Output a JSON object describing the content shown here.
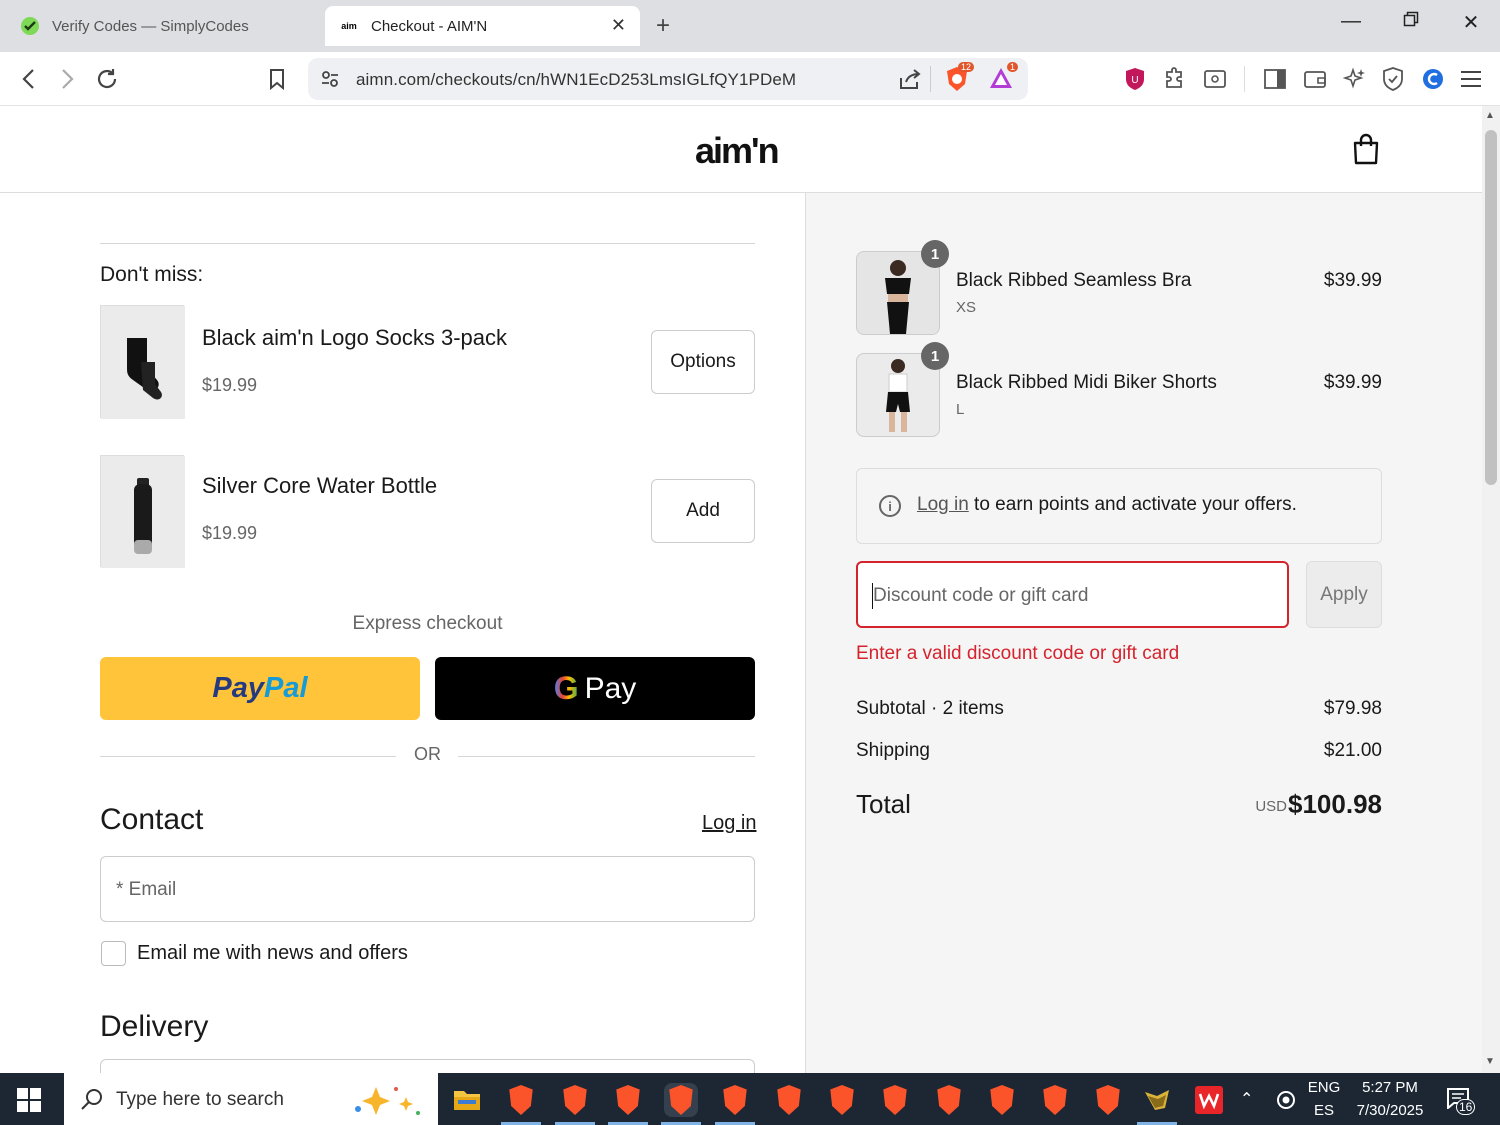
{
  "browser": {
    "tabs": [
      {
        "title": "Verify Codes — SimplyCodes",
        "active": false
      },
      {
        "title": "Checkout - AIM'N",
        "active": true
      }
    ],
    "url": "aimn.com/checkouts/cn/hWN1EcD253LmsIGLfQY1PDeM",
    "brave_shield_count": "12",
    "rewards_count": "1"
  },
  "site": {
    "logo": "aim'n"
  },
  "upsell": {
    "title": "Don't miss:",
    "items": [
      {
        "name": "Black aim'n Logo Socks 3-pack",
        "price": "$19.99",
        "button": "Options"
      },
      {
        "name": "Silver Core Water Bottle",
        "price": "$19.99",
        "button": "Add"
      }
    ]
  },
  "express": {
    "label": "Express checkout",
    "paypal_a": "Pay",
    "paypal_b": "Pal",
    "gpay_g": "G",
    "gpay_text": "Pay",
    "or": "OR"
  },
  "contact": {
    "heading": "Contact",
    "login": "Log in",
    "email_placeholder": "* Email",
    "newsletter_label": "Email me with news and offers"
  },
  "delivery": {
    "heading": "Delivery"
  },
  "summary": {
    "items": [
      {
        "name": "Black Ribbed Seamless Bra",
        "variant": "XS",
        "price": "$39.99",
        "qty": "1"
      },
      {
        "name": "Black Ribbed Midi Biker Shorts",
        "variant": "L",
        "price": "$39.99",
        "qty": "1"
      }
    ],
    "login_link": "Log in",
    "login_text": " to earn points and activate your offers.",
    "discount_placeholder": "Discount code or gift card",
    "apply": "Apply",
    "error": "Enter a valid discount code or gift card",
    "subtotal_label": "Subtotal · 2 items",
    "subtotal_value": "$79.98",
    "shipping_label": "Shipping",
    "shipping_value": "$21.00",
    "total_label": "Total",
    "total_currency": "USD",
    "total_value": "$100.98"
  },
  "taskbar": {
    "search_placeholder": "Type here to search",
    "lang1": "ENG",
    "lang2": "ES",
    "time": "5:27 PM",
    "date": "7/30/2025",
    "notifications": "16"
  },
  "colors": {
    "error": "#d5232d",
    "paypal": "#ffc439",
    "brave": "#fb542b"
  }
}
